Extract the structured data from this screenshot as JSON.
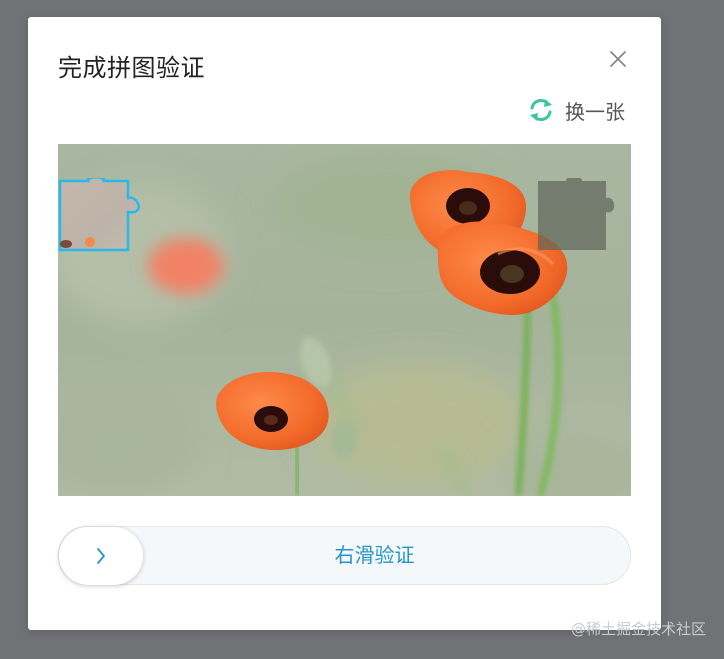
{
  "dialog": {
    "title": "完成拼图验证",
    "refresh_label": "换一张",
    "close_icon": "close-icon",
    "refresh_icon": "refresh-icon"
  },
  "slider": {
    "hint": "右滑验证",
    "handle_icon": "chevron-right-icon",
    "progress": 0
  },
  "watermark": "@稀土掘金技术社区",
  "colors": {
    "accent": "#2596c8",
    "refresh_green": "#3cc79a",
    "piece_outline": "#29b8ea",
    "modal_bg": "#ffffff",
    "overlay": "#707276"
  }
}
